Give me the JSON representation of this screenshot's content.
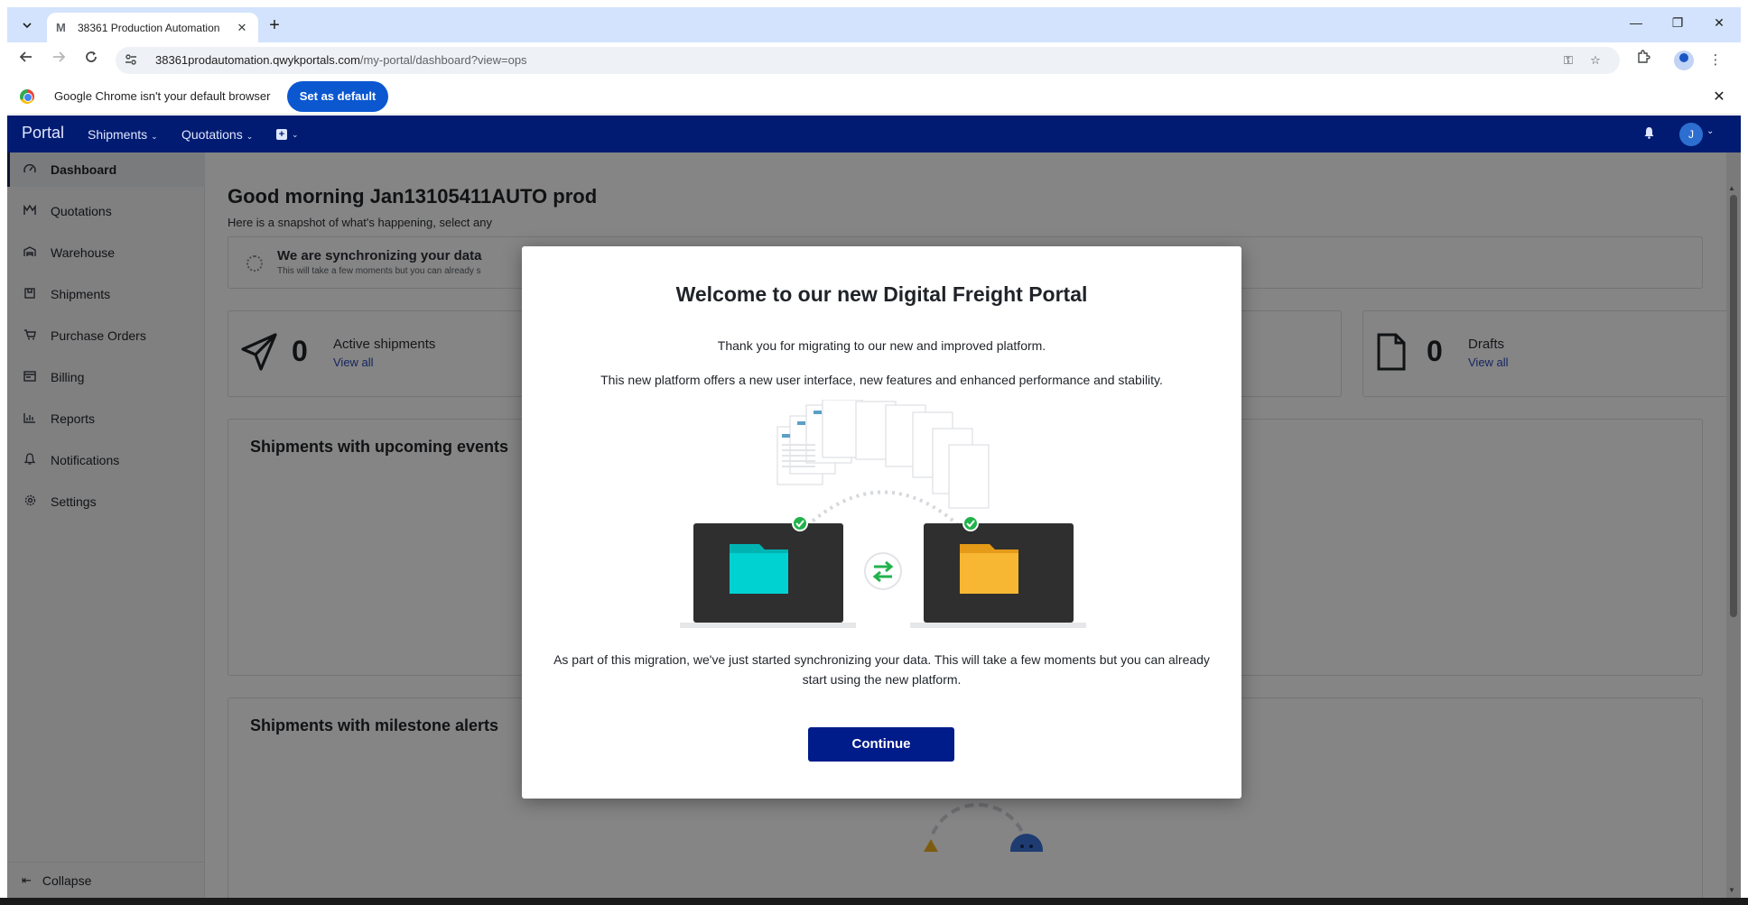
{
  "browser": {
    "tab_title": "38361 Production Automation",
    "tab_favicon": "M",
    "url_host": "38361prodautomation.qwykportals.com",
    "url_path": "/my-portal/dashboard?view=ops",
    "infobar_text": "Google Chrome isn't your default browser",
    "set_default_label": "Set as default"
  },
  "topnav": {
    "brand": "Portal",
    "menu": [
      {
        "label": "Shipments"
      },
      {
        "label": "Quotations"
      }
    ],
    "avatar_initial": "J"
  },
  "sidebar": {
    "items": [
      {
        "label": "Dashboard",
        "icon": "gauge-icon"
      },
      {
        "label": "Quotations",
        "icon": "quotations-icon"
      },
      {
        "label": "Warehouse",
        "icon": "warehouse-icon"
      },
      {
        "label": "Shipments",
        "icon": "box-icon"
      },
      {
        "label": "Purchase Orders",
        "icon": "cart-icon"
      },
      {
        "label": "Billing",
        "icon": "billing-icon"
      },
      {
        "label": "Reports",
        "icon": "chart-icon"
      },
      {
        "label": "Notifications",
        "icon": "bell-icon"
      },
      {
        "label": "Settings",
        "icon": "gear-icon"
      }
    ],
    "collapse_label": "Collapse"
  },
  "main": {
    "greeting": "Good morning Jan13105411AUTO prod",
    "subtitle": "Here is a snapshot of what's happening, select any",
    "sync_title": "We are synchronizing your data",
    "sync_sub": "This will take a few moments but you can already s",
    "stats": [
      {
        "value": "0",
        "label": "Active shipments",
        "link": "View all"
      },
      {
        "value": "0",
        "label": "Drafts",
        "link": "View all"
      }
    ],
    "panels": [
      {
        "title": "Shipments with upcoming events"
      },
      {
        "title": "Shipments with milestone alerts"
      }
    ]
  },
  "modal": {
    "title": "Welcome to our new Digital Freight Portal",
    "p1": "Thank you for migrating to our new and improved platform.",
    "p2": "This new platform offers a new user interface, new features and enhanced performance and stability.",
    "p3": "As part of this migration, we've just started synchronizing your data. This will take a few moments but you can already start using the new platform.",
    "continue_label": "Continue"
  },
  "colors": {
    "nav_bg": "#001b71",
    "primary_button": "#001b8a",
    "chrome_tabstrip": "#d3e3fd",
    "chrome_blue": "#0b57d0",
    "folder_teal": "#00c8c8",
    "folder_yellow": "#f7b733",
    "check_green": "#22b24c"
  }
}
